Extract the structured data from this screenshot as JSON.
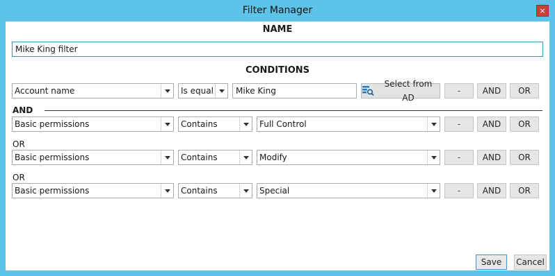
{
  "window": {
    "title": "Filter Manager",
    "close_glyph": "×"
  },
  "name_section": {
    "heading": "NAME",
    "value": "Mike King filter"
  },
  "conditions": {
    "heading": "CONDITIONS",
    "first": {
      "field": "Account name",
      "operator": "Is equal t",
      "value": "Mike King",
      "select_ad_label": "Select from AD",
      "select_ad_icon": "directory-search-icon",
      "minus_label": "-",
      "and_label": "AND",
      "or_label": "OR"
    },
    "rows": [
      {
        "connector": "AND",
        "field": "Basic permissions",
        "operator": "Contains",
        "value": "Full Control",
        "minus_label": "-",
        "and_label": "AND",
        "or_label": "OR"
      },
      {
        "connector": "OR",
        "field": "Basic permissions",
        "operator": "Contains",
        "value": "Modify",
        "minus_label": "-",
        "and_label": "AND",
        "or_label": "OR"
      },
      {
        "connector": "OR",
        "field": "Basic permissions",
        "operator": "Contains",
        "value": "Special",
        "minus_label": "-",
        "and_label": "AND",
        "or_label": "OR"
      }
    ]
  },
  "footer": {
    "save_label": "Save",
    "cancel_label": "Cancel"
  },
  "colors": {
    "frame": "#5ec3e8",
    "close": "#c7403a",
    "focus_border": "#3b8ec8"
  }
}
